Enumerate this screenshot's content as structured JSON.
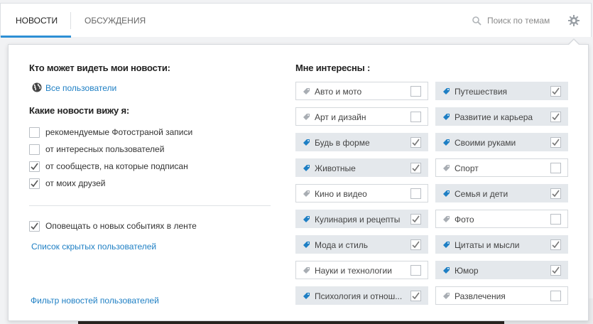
{
  "tabs": [
    {
      "label": "НОВОСТИ",
      "active": true
    },
    {
      "label": "ОБСУЖДЕНИЯ",
      "active": false
    }
  ],
  "search": {
    "placeholder": "Поиск по темам"
  },
  "icons": {
    "search": "search-icon",
    "settings": "gear-icon",
    "globe": "globe-icon",
    "tag": "tag-icon",
    "check": "check-icon"
  },
  "colors": {
    "accent": "#2d8fd5",
    "link": "#1e7fc4",
    "tag_on_bg": "#e4e8ec",
    "tag_icon_on": "#1e7fc4",
    "tag_icon_off": "#a8adb3"
  },
  "privacy": {
    "heading": "Кто может видеть мои новости:",
    "value": "Все пользователи"
  },
  "news_filter": {
    "heading": "Какие новости вижу я:",
    "options": [
      {
        "label": "рекомендуемые Фотостраной записи",
        "checked": false
      },
      {
        "label": "от интересных пользователей",
        "checked": false
      },
      {
        "label": "от сообществ, на которые подписан",
        "checked": true
      },
      {
        "label": "от моих друзей",
        "checked": true
      }
    ]
  },
  "notify": {
    "label": "Оповещать о новых событиях в ленте",
    "checked": true
  },
  "hidden_users_link": "Список скрытых пользователей",
  "user_filter_link": "Фильтр новостей пользователей",
  "interests": {
    "heading": "Мне интересны :",
    "left": [
      {
        "label": "Авто и мото",
        "checked": false
      },
      {
        "label": "Арт и дизайн",
        "checked": false
      },
      {
        "label": "Будь в форме",
        "checked": true
      },
      {
        "label": "Животные",
        "checked": true
      },
      {
        "label": "Кино и видео",
        "checked": false
      },
      {
        "label": "Кулинария и рецепты",
        "checked": true
      },
      {
        "label": "Мода и стиль",
        "checked": true
      },
      {
        "label": "Науки и технологии",
        "checked": false
      },
      {
        "label": "Психология и отнош...",
        "checked": true
      }
    ],
    "right": [
      {
        "label": "Путешествия",
        "checked": true
      },
      {
        "label": "Развитие и карьера",
        "checked": true
      },
      {
        "label": "Своими руками",
        "checked": true
      },
      {
        "label": "Спорт",
        "checked": false
      },
      {
        "label": "Семья и дети",
        "checked": true
      },
      {
        "label": "Фото",
        "checked": false
      },
      {
        "label": "Цитаты и мысли",
        "checked": true
      },
      {
        "label": "Юмор",
        "checked": true
      },
      {
        "label": "Развлечения",
        "checked": false
      }
    ]
  }
}
